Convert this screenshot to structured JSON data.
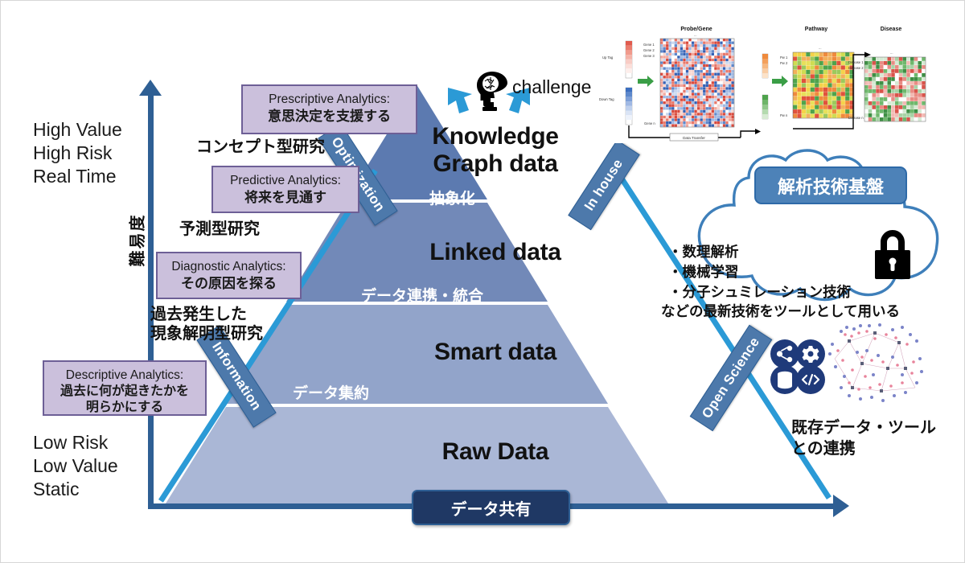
{
  "axis": {
    "vertical_label": "難易度",
    "top_label": "High Value\nHigh Risk\nReal Time",
    "bottom_label": "Low Risk\nLow Value\nStatic"
  },
  "pyramid": {
    "layers": [
      {
        "title": "Knowledge\nGraph data",
        "sub": "抽象化",
        "color": "#5c7ab0"
      },
      {
        "title": "Linked data",
        "sub": "データ連携・統合",
        "color": "#7289b8"
      },
      {
        "title": "Smart data",
        "sub": "データ集約",
        "color": "#92a4ca"
      },
      {
        "title": "Raw Data",
        "sub": "",
        "color": "#aab7d6"
      }
    ]
  },
  "callouts": [
    {
      "en": "Prescriptive Analytics:",
      "jp": "意思決定を支援する"
    },
    {
      "en": "Predictive Analytics:",
      "jp": "将来を見通す"
    },
    {
      "en": "Diagnostic Analytics:",
      "jp": "その原因を探る"
    },
    {
      "en": "Descriptive Analytics:",
      "jp": "過去に何が起きたかを\n明らかにする"
    }
  ],
  "research_labels": {
    "concept": "コンセプト型研究",
    "predictive": "予測型研究",
    "past": "過去発生した\n現象解明型研究"
  },
  "ribbons": {
    "optimization": "Optimization",
    "information": "Information",
    "in_house": "In house",
    "open_science": "Open Science"
  },
  "challenge": {
    "label": "challenge",
    "icon": "head-brain-icon"
  },
  "data_share": "データ共有",
  "cloud": {
    "pill": "解析技術基盤",
    "items": "・数理解析\n・機械学習\n・分子シュミレーション技術",
    "note": "などの最新技術をツールとして用いる",
    "lock_icon": "lock-icon"
  },
  "open_science_panel": {
    "caption": "既存データ・ツール\nとの連携",
    "icons": [
      "share-icon",
      "gear-icon",
      "database-icon",
      "code-icon"
    ],
    "graph_icon": "network-graph-icon"
  },
  "heatmap_pipeline": {
    "titles": [
      "Probe/Gene",
      "Pathway",
      "Disease"
    ],
    "tags": [
      "Up Tag",
      "Down Tag"
    ],
    "transfer": "Data Transfer",
    "ellipsis": "...",
    "row_labels_gene": [
      "Gene 1",
      "Gene 2",
      "Gene 3",
      "Gene n"
    ],
    "row_labels_pathway": [
      "Pw 1",
      "Pw 2",
      "Pw n"
    ],
    "row_labels_disease": [
      "Disease 1",
      "Disease 2",
      "Disease n"
    ]
  },
  "colors": {
    "axis": "#2e5f94",
    "accent_blue": "#2b9ad6",
    "ribbon": "#4d79ab",
    "callout_fill": "#cbc0dc",
    "callout_border": "#6d5f96",
    "navy": "#1f3864"
  }
}
